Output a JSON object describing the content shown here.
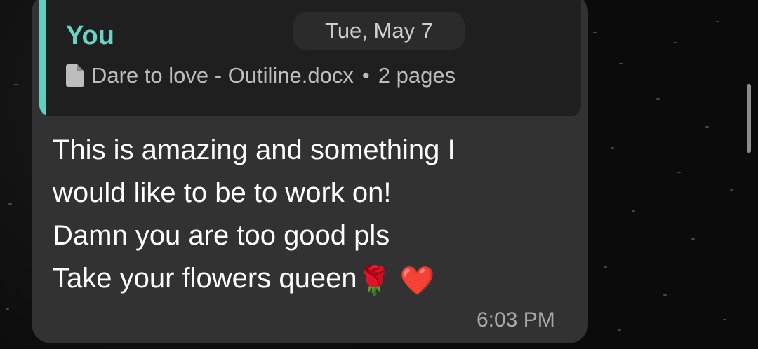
{
  "date_separator": "Tue, May 7",
  "message": {
    "reply_quote": {
      "author": "You",
      "document_name": "Dare to love - Outiline.docx",
      "separator": "•",
      "pages": "2 pages",
      "icon": "document-icon"
    },
    "lines": [
      "This is amazing and something I",
      "would like to be to work on!",
      "Damn you are too good pls",
      "Take your flowers queen"
    ],
    "emojis": [
      "🌹",
      "❤️"
    ],
    "time": "6:03 PM"
  },
  "colors": {
    "bubble": "#323232",
    "quote_bg": "#1f1f1f",
    "quote_accent": "#5fcfc0",
    "author": "#6bd3c5",
    "background": "#0b0b0b"
  }
}
